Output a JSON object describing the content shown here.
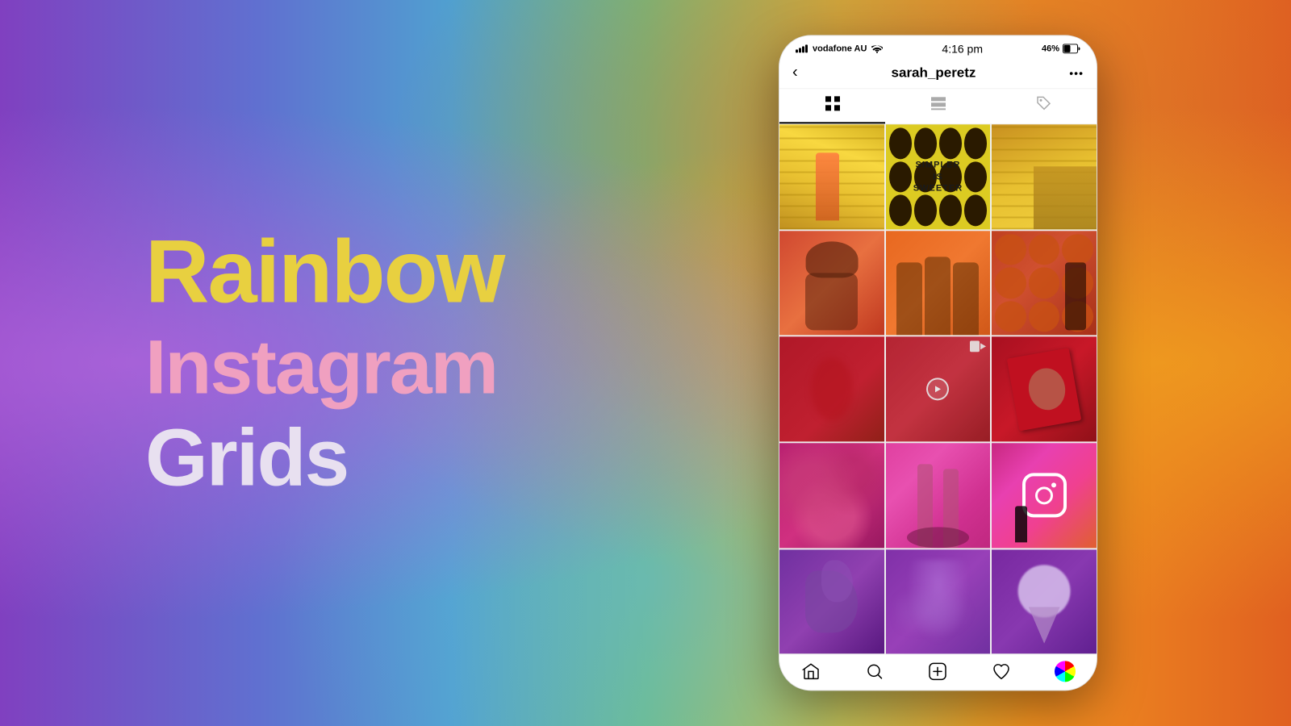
{
  "background": {
    "gradient": "rainbow diagonal"
  },
  "text": {
    "line1": "Rainbow",
    "line2": "Instagram",
    "line3": "Grids"
  },
  "phone": {
    "status_bar": {
      "carrier": "vodafone AU",
      "time": "4:16 pm",
      "battery": "46%",
      "battery_icon": "battery-icon",
      "wifi_icon": "wifi-icon",
      "signal_icon": "signal-icon"
    },
    "header": {
      "back_label": "‹",
      "username": "sarah_peretz",
      "more_label": "•••"
    },
    "tabs": {
      "grid_icon": "⊞",
      "list_icon": "☰",
      "tag_icon": "⊙"
    },
    "grid": {
      "rows": [
        [
          "yellow-stairs-left",
          "yellow-flowers-text",
          "yellow-stairs-right"
        ],
        [
          "orange-face",
          "orange-group",
          "orange-pumpkins"
        ],
        [
          "red-person",
          "red-blur-video",
          "red-book"
        ],
        [
          "pink-flowers",
          "pink-legs",
          "pink-instagram"
        ],
        [
          "purple-hands",
          "purple-smoke",
          "purple-icecream"
        ]
      ]
    },
    "nav": {
      "home_label": "home",
      "search_label": "search",
      "add_label": "add",
      "heart_label": "heart",
      "profile_label": "profile"
    },
    "simpler_text": {
      "line1": "SIMPLER",
      "line2": "IS",
      "line3": "SWEETER"
    }
  }
}
